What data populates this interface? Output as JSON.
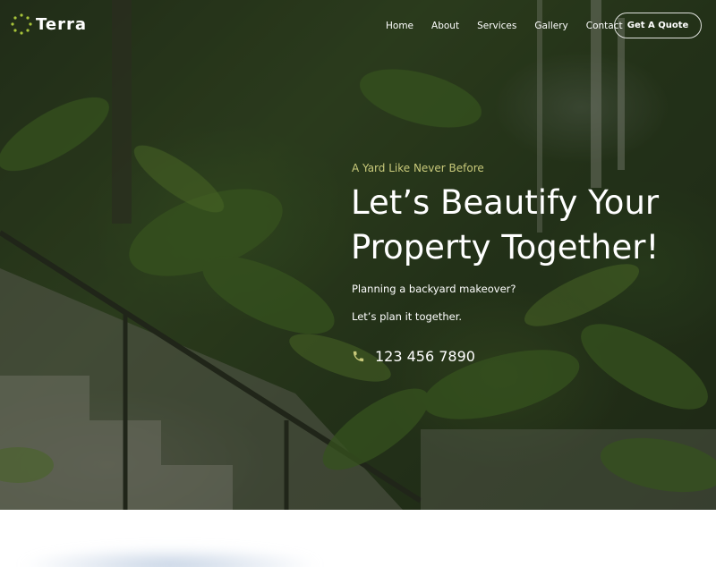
{
  "brand": {
    "name": "Terra",
    "accent_color": "#a8c43a"
  },
  "nav": {
    "items": [
      {
        "label": "Home"
      },
      {
        "label": "About"
      },
      {
        "label": "Services"
      },
      {
        "label": "Gallery"
      },
      {
        "label": "Contact"
      }
    ],
    "cta_label": "Get A Quote"
  },
  "hero": {
    "eyebrow": "A Yard Like Never Before",
    "headline_line1": "Let’s Beautify Your",
    "headline_line2": "Property Together!",
    "sub1": "Planning a backyard makeover?",
    "sub2": "Let’s plan it together.",
    "phone_icon": "phone-icon",
    "phone_number": "123 456 7890",
    "eyebrow_color": "#c8c97a"
  }
}
